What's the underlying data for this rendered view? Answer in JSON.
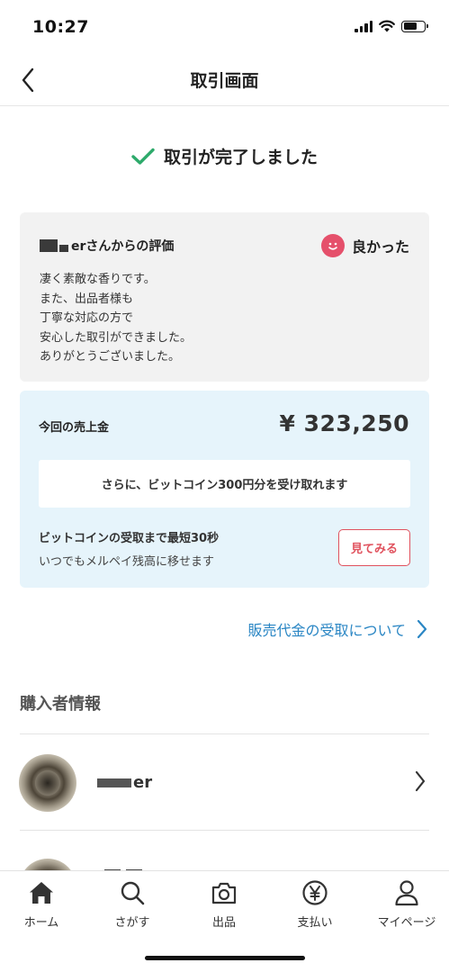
{
  "status_bar": {
    "time": "10:27"
  },
  "nav": {
    "title": "取引画面"
  },
  "completion": {
    "message": "取引が完了しました",
    "accent_color": "#2eaa6b"
  },
  "review": {
    "reviewer_suffix": "erさんからの評価",
    "rating_label": "良かった",
    "rating_color": "#e5506b",
    "comment_lines": [
      "凄く素敵な香りです。",
      "また、出品者様も",
      "丁寧な対応の方で",
      "安心した取引ができました。",
      "ありがとうございました。"
    ]
  },
  "sales": {
    "label": "今回の売上金",
    "amount": "¥ 323,250",
    "bitcoin_banner": "さらに、ビットコイン300円分を受け取れます",
    "bitcoin_title": "ビットコインの受取まで最短30秒",
    "bitcoin_subtitle": "いつでもメルペイ残高に移せます",
    "look_button": "見てみる",
    "button_color": "#e0525e",
    "card_color": "#e6f4fb"
  },
  "receive_link": {
    "label": "販売代金の受取について",
    "color": "#2a86c4"
  },
  "buyer_section": {
    "title": "購入者情報",
    "buyer_name_suffix": "er"
  },
  "tab_bar": {
    "items": [
      {
        "label": "ホーム",
        "icon": "home-icon"
      },
      {
        "label": "さがす",
        "icon": "search-icon"
      },
      {
        "label": "出品",
        "icon": "camera-icon"
      },
      {
        "label": "支払い",
        "icon": "yen-icon"
      },
      {
        "label": "マイページ",
        "icon": "person-icon"
      }
    ]
  }
}
